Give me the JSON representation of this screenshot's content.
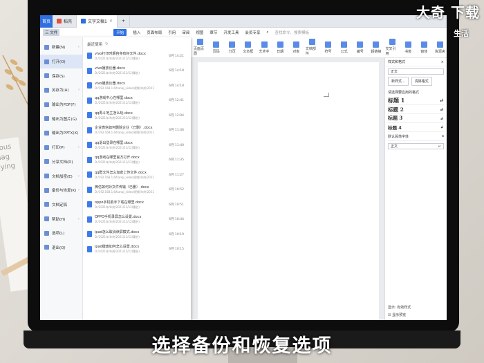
{
  "watermark": "大奇 下载",
  "watermark_sub": "生活",
  "subtitle": "选择备份和恢复选项",
  "background_paper_text": "cious fliag\nflying",
  "tabs": [
    {
      "label": "首页",
      "active": false
    },
    {
      "label": "稻壳",
      "active": false,
      "color": "#e04f3f"
    },
    {
      "label": "文字文稿1",
      "active": true,
      "color": "#2f6fe0"
    }
  ],
  "menubar": {
    "file_label": "三 文件",
    "items": [
      "开始",
      "插入",
      "页面布局",
      "引用",
      "审阅",
      "视图",
      "章节",
      "开发工具",
      "会员专享"
    ],
    "search": "查找命令、搜索模板"
  },
  "ribbon_items": [
    "页面页眉",
    "页码",
    "分页",
    "文本框",
    "艺术字",
    "日期",
    "对象",
    "文档部件",
    "符号",
    "公式",
    "编号",
    "超链接",
    "交叉引用",
    "书签",
    "窗体",
    "资源夹"
  ],
  "file_menu": {
    "items": [
      {
        "label": "新建(N)",
        "arrow": true
      },
      {
        "label": "打开(O)",
        "arrow": false,
        "active": true
      },
      {
        "label": "保存(S)",
        "arrow": false
      },
      {
        "label": "另存为(A)",
        "arrow": true
      },
      {
        "label": "输出为PDF(F)",
        "arrow": false
      },
      {
        "label": "输出为图片(G)",
        "arrow": false
      },
      {
        "label": "输出为PPTX(X)",
        "arrow": false
      },
      {
        "label": "打印(P)",
        "arrow": true
      },
      {
        "label": "分享文档(D)",
        "arrow": false
      },
      {
        "label": "文档加密(E)",
        "arrow": true
      },
      {
        "label": "备份与恢复(K)",
        "arrow": true
      },
      {
        "label": "文档定稿",
        "arrow": false
      },
      {
        "label": "帮助(H)",
        "arrow": true
      },
      {
        "label": "选项(L)",
        "arrow": false
      },
      {
        "label": "退出(Q)",
        "arrow": false
      }
    ],
    "recent_header": "最近使用",
    "recent": [
      {
        "name": "vivo打印时期自身有好文件.docx",
        "path": "D:/2021年/年终/2021/11/12(署名)",
        "date": "6月 14:21"
      },
      {
        "name": "vivo播放仪器.docx",
        "path": "D:/2021年/年终/2021/11/12(署名)",
        "date": "6月 14:18"
      },
      {
        "name": "vivo播放仪器.docx",
        "path": "D:/192.168.1.6/tianqi_video/视频/年终/2021",
        "date": "6月 14:18"
      },
      {
        "name": "qq游戏中心在哪里.docx",
        "path": "D:/2021年/年终/2021/11/12(署名)",
        "date": "6月 12:41"
      },
      {
        "name": "qq再斗地主怎么玩.docx",
        "path": "D:/2021年/年终/2021/11/12(署名)",
        "date": "6月 12:04"
      },
      {
        "name": "企业微信如何删除企业（已删）.docx",
        "path": "D:/192.168.1.6/tianqi_video/视频/年终/2021",
        "date": "6月 11:46"
      },
      {
        "name": "qq退出登录在哪里.docx",
        "path": "D:/2021年/年终/2021/11/12(署名)",
        "date": "6月 11:40"
      },
      {
        "name": "qq游戏在哪里官方打开.docx",
        "path": "D:/2021年/年终/2021/11/12(署名)",
        "date": "6月 11:35"
      },
      {
        "name": "qq群文件怎么加密上传文件.docx",
        "path": "D:/192.168.1.6/tianqi_video/视频/年终/2021",
        "date": "6月 11:27"
      },
      {
        "name": "微信如何对文件传输（已删）.docx",
        "path": "D:/192.168.1.6/tianqi_video/视频/年终/2021",
        "date": "6月 10:52"
      },
      {
        "name": "oppo手机助手下载在哪里.docx",
        "path": "D:/2021年/年终/2021/11/12(署名)",
        "date": "6月 10:51"
      },
      {
        "name": "OPPO手机录屏怎么设置.docx",
        "path": "D:/2021年/年终/2021/11/12(署名)",
        "date": "6月 10:44"
      },
      {
        "name": "ipad怎么取消读屏模式.docx",
        "path": "D:/2021年/年终/2021/11/12(署名)",
        "date": "6月 10:19"
      },
      {
        "name": "ipad键盘如何怎么设置.docx",
        "path": "D:/2021年/年终/2021/11/12(署名)",
        "date": "6月 10:15"
      }
    ]
  },
  "side_panel": {
    "title": "样式和格式",
    "current": "正文",
    "btn_new": "新样式...",
    "btn_clear": "清除格式",
    "apply_label": "请选择要应用的格式",
    "styles": [
      "标题 1",
      "标题 2",
      "标题 3",
      "标题 4"
    ],
    "default_font": "默认段落字体",
    "body": "正文",
    "show_label": "显示:",
    "show_value": "有效样式",
    "preview": "显示预览"
  }
}
